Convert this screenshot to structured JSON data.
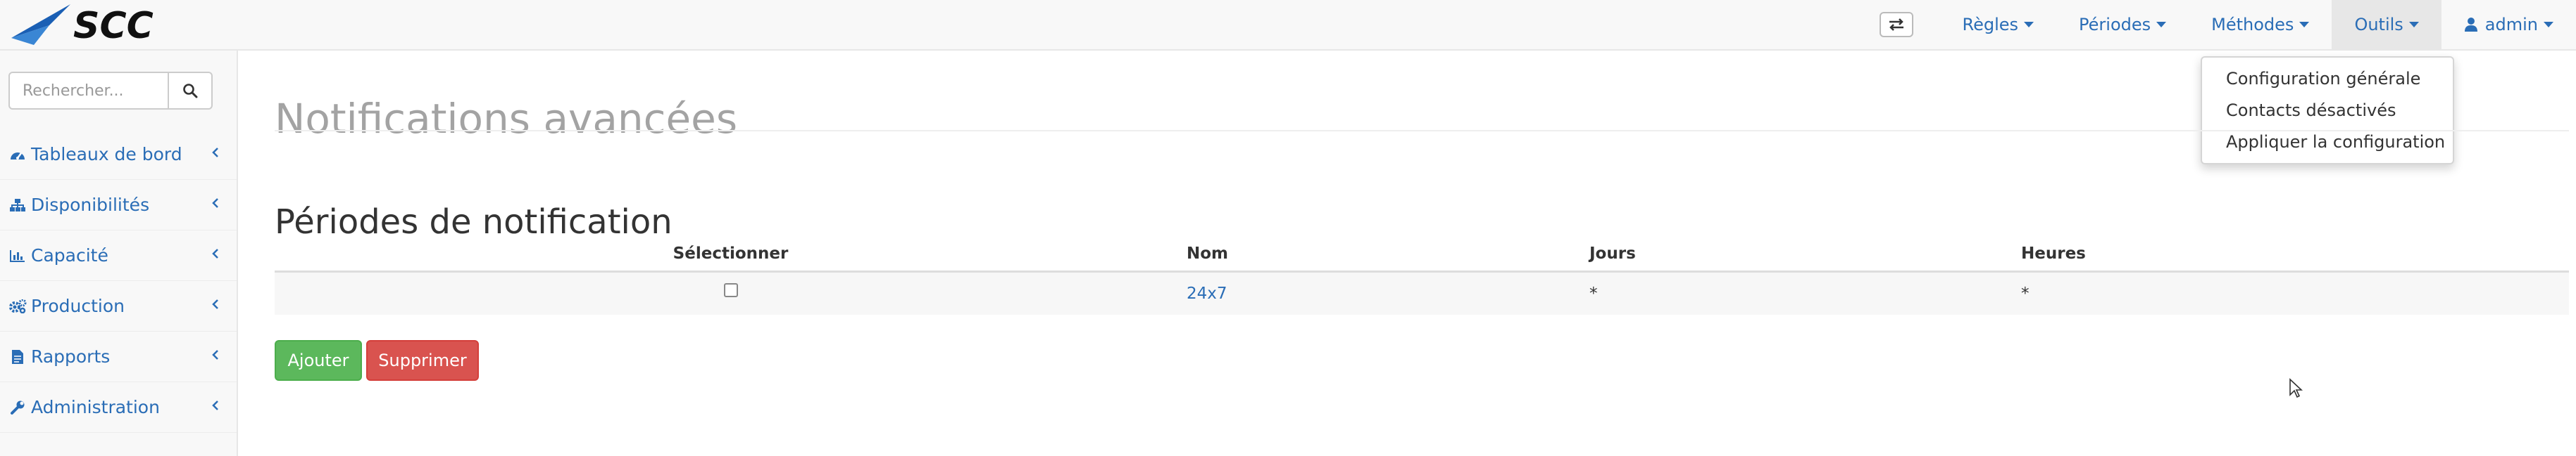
{
  "brand": {
    "name": "SCC",
    "logo_color": "#1a4fa0"
  },
  "navbar": {
    "swap_icon": "exchange-icon",
    "items": [
      {
        "label": "Règles"
      },
      {
        "label": "Périodes"
      },
      {
        "label": "Méthodes"
      },
      {
        "label": "Outils"
      }
    ],
    "user": {
      "label": "admin",
      "icon": "user-icon"
    }
  },
  "dropdown": {
    "items": [
      {
        "label": "Configuration générale"
      },
      {
        "label": "Contacts désactivés"
      },
      {
        "label": "Appliquer la configuration"
      }
    ]
  },
  "sidebar": {
    "search": {
      "placeholder": "Rechercher...",
      "icon": "search-icon"
    },
    "items": [
      {
        "label": "Tableaux de bord",
        "icon": "dashboard-icon"
      },
      {
        "label": "Disponibilités",
        "icon": "sitemap-icon"
      },
      {
        "label": "Capacité",
        "icon": "bar-chart-icon"
      },
      {
        "label": "Production",
        "icon": "cogs-icon"
      },
      {
        "label": "Rapports",
        "icon": "file-icon"
      },
      {
        "label": "Administration",
        "icon": "wrench-icon"
      }
    ]
  },
  "main": {
    "page_title": "Notifications avancées",
    "section_title": "Périodes de notification",
    "table": {
      "headers": [
        "Sélectionner",
        "Nom",
        "Jours",
        "Heures"
      ],
      "rows": [
        {
          "checked": false,
          "nom": "24x7",
          "jours": "*",
          "heures": "*"
        }
      ]
    },
    "buttons": {
      "add": "Ajouter",
      "delete": "Supprimer"
    }
  },
  "colors": {
    "link": "#2a6db6",
    "success": "#5cb85c",
    "danger": "#d9534f",
    "navbar_bg": "#f8f8f8"
  }
}
